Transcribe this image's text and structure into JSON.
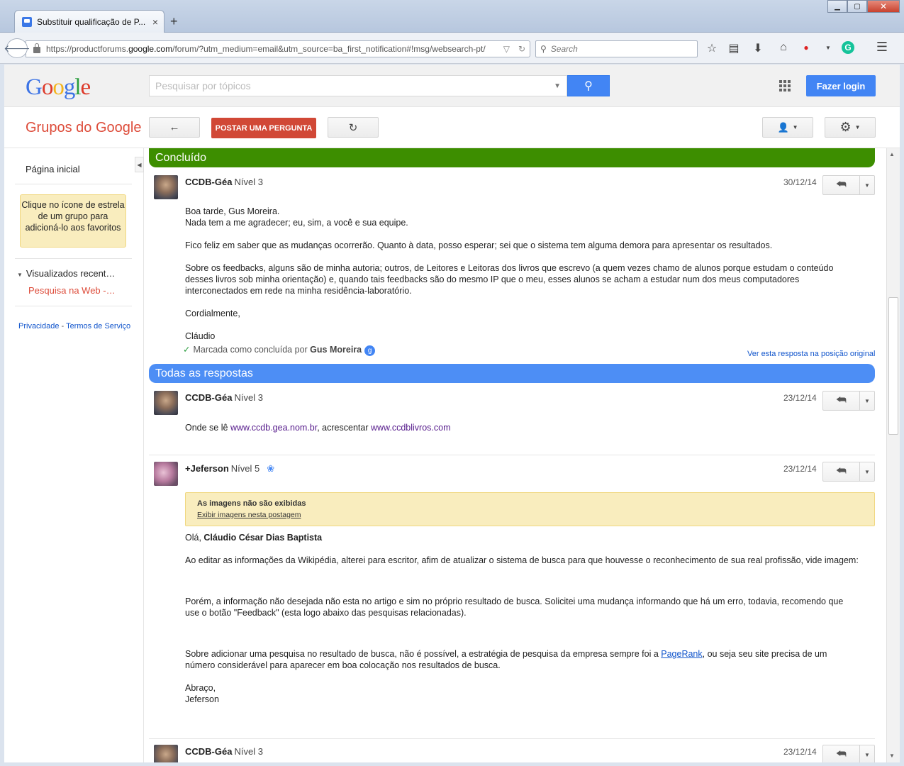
{
  "browser": {
    "tab_title": "Substituir qualificação de P...",
    "tab_close": "×",
    "new_tab": "+",
    "url_prefix": "https://productforums.",
    "url_host": "google.com",
    "url_path": "/forum/?utm_medium=email&utm_source=ba_first_notification#!msg/websearch-pt/",
    "search_placeholder": "Search"
  },
  "header": {
    "logo": [
      "G",
      "o",
      "o",
      "g",
      "l",
      "e"
    ],
    "search_placeholder": "Pesquisar por tópicos",
    "login_label": "Fazer login"
  },
  "toolbar": {
    "title": "Grupos do Google",
    "post_label": "POSTAR UMA PERGUNTA"
  },
  "sidebar": {
    "home": "Página inicial",
    "tip": "Clique no ícone de estrela de um grupo para adicioná-lo aos favoritos",
    "recent_label": "Visualizados recent…",
    "recent_item": "Pesquisa na Web -…",
    "privacy": "Privacidade",
    "sep": " - ",
    "terms": "Termos de Serviço"
  },
  "sections": {
    "concluded": "Concluído",
    "all_answers": "Todas as respostas"
  },
  "posts": {
    "p1": {
      "author": "CCDB-Géa",
      "level": "Nível 3",
      "date": "30/12/14",
      "l1": "Boa tarde, Gus Moreira.",
      "l2": "Nada tem a me agradecer; eu, sim, a você e sua equipe.",
      "p2": "Fico feliz em saber que as mudanças ocorrerão. Quanto à data, posso esperar; sei que o sistema tem alguma demora para apresentar os resultados.",
      "p3": "Sobre os feedbacks, alguns são de minha autoria; outros, de Leitores e Leitoras dos livros que escrevo (a quem vezes chamo de alunos porque estudam o conteúdo desses livros sob minha orientação) e, quando tais feedbacks são do mesmo IP que o meu, esses alunos se acham a estudar num dos meus computadores interconectados em rede na minha residência-laboratório.",
      "p4": "Cordialmente,",
      "p5": "Cláudio",
      "marked": "Marcada como concluída por",
      "marked_by": "Gus Moreira",
      "view_original": "Ver esta resposta na posição original"
    },
    "p2": {
      "author": "CCDB-Géa",
      "level": "Nível 3",
      "date": "23/12/14",
      "t1": "Onde se lê ",
      "link1": "www.ccdb.gea.nom.br",
      "t2": ", acrescentar ",
      "link2": "www.ccdblivros.com"
    },
    "p3": {
      "author": "+Jeferson",
      "level": "Nível 5",
      "date": "23/12/14",
      "img_title": "As imagens não são exibidas",
      "img_link": "Exibir imagens nesta postagem",
      "greet": "Olá, ",
      "greet_name": "Cláudio César Dias Baptista",
      "p1": "Ao editar as informações da Wikipédia, alterei para escritor, afim de atualizar o sistema de busca para que houvesse o reconhecimento de sua real profissão, vide imagem:",
      "p2": "Porém, a informação não desejada não esta no artigo e sim no próprio resultado de busca. Solicitei uma mudança informando que há um erro, todavia, recomendo que use o botão \"Feedback\" (esta logo abaixo das pesquisas relacionadas).",
      "p3a": "Sobre adicionar uma pesquisa no resultado de busca, não é possível, a estratégia de pesquisa da empresa sempre foi a ",
      "p3link": "PageRank",
      "p3b": ", ou seja seu site precisa de um número considerável para aparecer em boa colocação nos resultados de busca.",
      "sign1": "Abraço,",
      "sign2": "Jeferson"
    },
    "p4": {
      "author": "CCDB-Géa",
      "level": "Nível 3",
      "date": "23/12/14"
    }
  },
  "icons": {
    "back": "←",
    "reload": "↻",
    "reply": "↩↩",
    "caret": "▼",
    "gear": "⚙",
    "person": "👥",
    "check": "✓",
    "badge": "🎖",
    "gplus": "g"
  },
  "colors": {
    "concluded": "#3d8e00",
    "all_answers": "#4d8ef5",
    "red": "#dd4b39",
    "blue": "#4285f4"
  }
}
